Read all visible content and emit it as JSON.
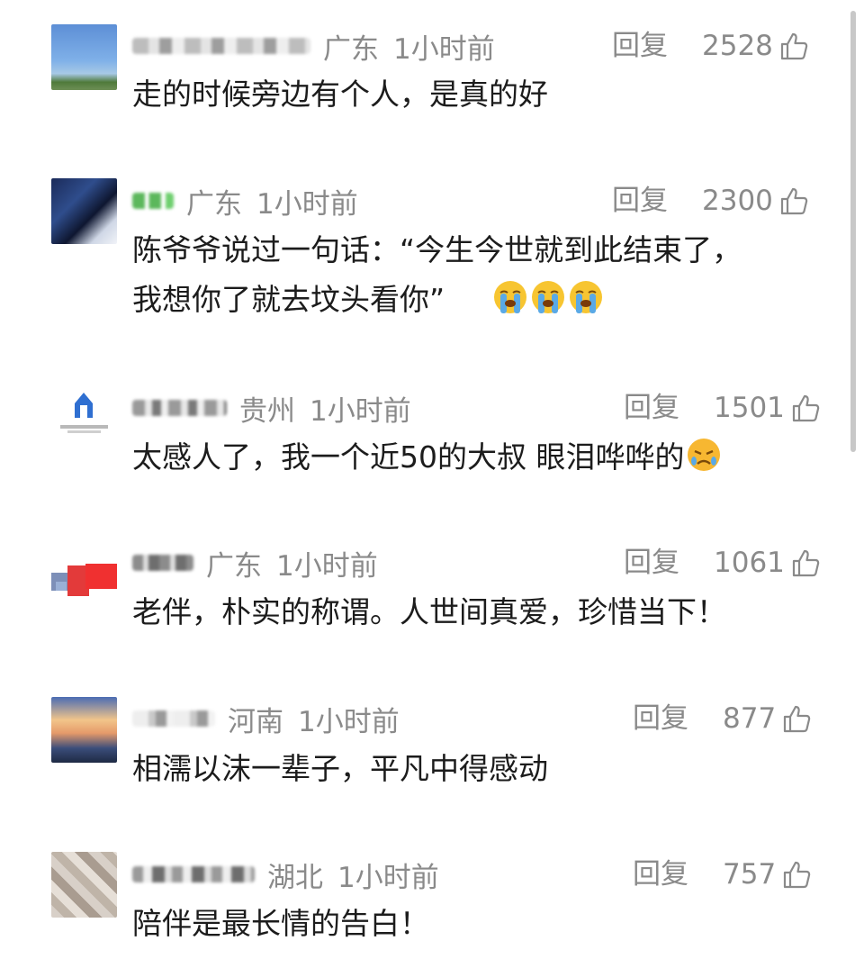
{
  "comments": [
    {
      "region": "广东",
      "time": "1小时前",
      "reply": "回复",
      "likes": "2528",
      "text": "走的时候旁边有个人，是真的好"
    },
    {
      "region": "广东",
      "time": "1小时前",
      "reply": "回复",
      "likes": "2300",
      "text": "陈爷爷说过一句话：“今生今世就到此结束了，",
      "text2": "我想你了就去坟头看你”"
    },
    {
      "region": "贵州",
      "time": "1小时前",
      "reply": "回复",
      "likes": "1501",
      "text": "太感人了，我一个近50的大叔 眼泪哗哗的"
    },
    {
      "region": "广东",
      "time": "1小时前",
      "reply": "回复",
      "likes": "1061",
      "text": "老伴，朴实的称谓。人世间真爱，珍惜当下！"
    },
    {
      "region": "河南",
      "time": "1小时前",
      "reply": "回复",
      "likes": "877",
      "text": "相濡以沫一辈子，平凡中得感动"
    },
    {
      "region": "湖北",
      "time": "1小时前",
      "reply": "回复",
      "likes": "757",
      "text": "陪伴是最长情的告白！"
    }
  ],
  "icons": {
    "like": "thumbs-up-icon",
    "cry": "loudly-crying-face-emoji",
    "sad": "tearful-face-emoji"
  },
  "colors": {
    "meta_text": "#8a8a8a",
    "body_text": "#1c1c1c",
    "background": "#ffffff"
  }
}
